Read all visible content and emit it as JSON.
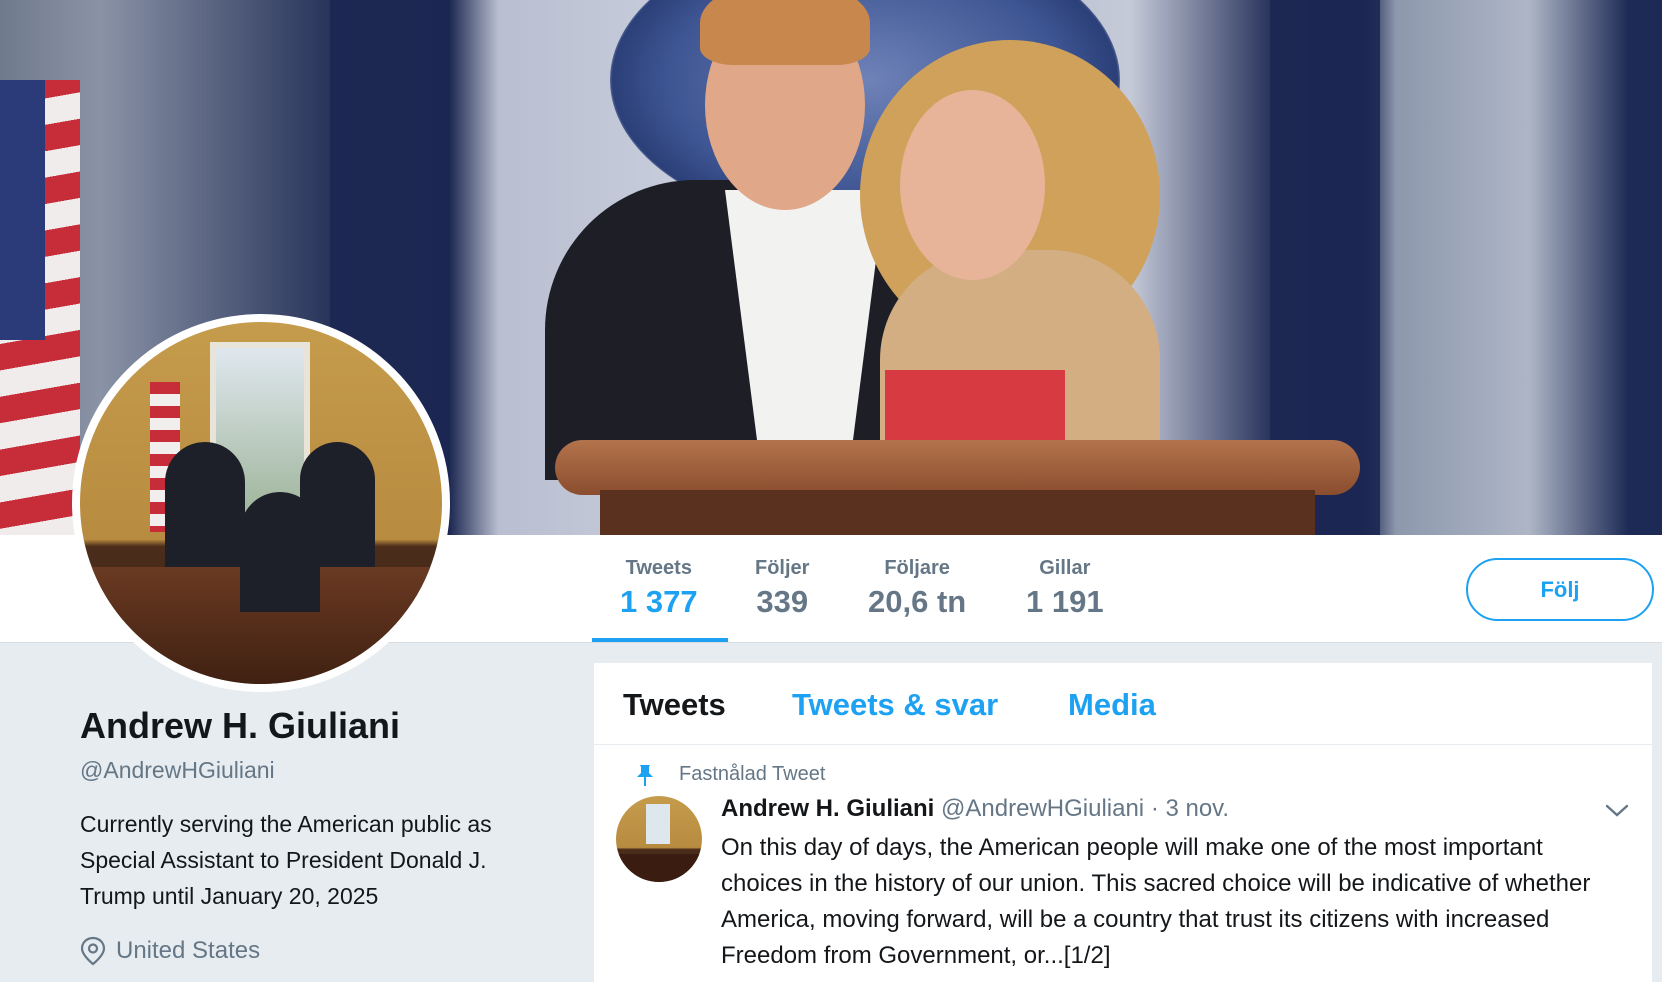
{
  "stats": [
    {
      "label": "Tweets",
      "value": "1 377"
    },
    {
      "label": "Följer",
      "value": "339"
    },
    {
      "label": "Följare",
      "value": "20,6 tn"
    },
    {
      "label": "Gillar",
      "value": "1 191"
    }
  ],
  "follow_button": "Följ",
  "profile": {
    "name": "Andrew H. Giuliani",
    "handle": "@AndrewHGiuliani",
    "bio": "Currently serving the American public as Special Assistant to President Donald J. Trump until January 20, 2025",
    "location": "United States"
  },
  "tabs": [
    "Tweets",
    "Tweets & svar",
    "Media"
  ],
  "tweet": {
    "pinned_label": "Fastnålad Tweet",
    "author_name": "Andrew H. Giuliani",
    "author_handle": "@AndrewHGiuliani",
    "date": "· 3 nov.",
    "text": "On this day of days, the American people will make one of the most important choices in the history of our union. This sacred choice will be indicative of whether America, moving forward, will be a country that trust its citizens with increased Freedom from Government, or...[1/2]"
  },
  "colors": {
    "accent": "#1da1f2",
    "muted": "#657786",
    "text": "#14171a",
    "background": "#e6ecf0"
  },
  "icons": [
    "location-pin-icon",
    "pin-icon",
    "chevron-down-icon"
  ]
}
